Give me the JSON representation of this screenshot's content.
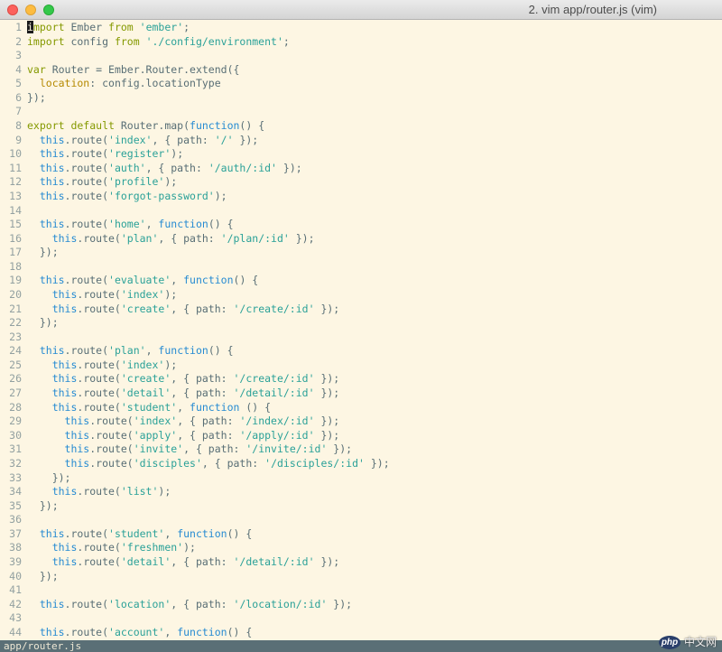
{
  "window": {
    "title": "2. vim app/router.js (vim)"
  },
  "editor": {
    "lines": [
      {
        "n": "1",
        "tokens": [
          {
            "t": "i",
            "c": "kw cursor"
          },
          {
            "t": "mport ",
            "c": "kw"
          },
          {
            "t": "Ember ",
            "c": ""
          },
          {
            "t": "from ",
            "c": "kw"
          },
          {
            "t": "'ember'",
            "c": "str"
          },
          {
            "t": ";",
            "c": ""
          }
        ]
      },
      {
        "n": "2",
        "tokens": [
          {
            "t": "import ",
            "c": "kw"
          },
          {
            "t": "config ",
            "c": ""
          },
          {
            "t": "from ",
            "c": "kw"
          },
          {
            "t": "'./config/environment'",
            "c": "str"
          },
          {
            "t": ";",
            "c": ""
          }
        ]
      },
      {
        "n": "3",
        "tokens": []
      },
      {
        "n": "4",
        "tokens": [
          {
            "t": "var ",
            "c": "kw"
          },
          {
            "t": "Router = Ember.Router.extend({",
            "c": ""
          }
        ]
      },
      {
        "n": "5",
        "tokens": [
          {
            "t": "  location",
            "c": "prop"
          },
          {
            "t": ": config.locationType",
            "c": ""
          }
        ]
      },
      {
        "n": "6",
        "tokens": [
          {
            "t": "});",
            "c": ""
          }
        ]
      },
      {
        "n": "7",
        "tokens": []
      },
      {
        "n": "8",
        "tokens": [
          {
            "t": "export default ",
            "c": "kw"
          },
          {
            "t": "Router.map(",
            "c": ""
          },
          {
            "t": "function",
            "c": "tt"
          },
          {
            "t": "() {",
            "c": ""
          }
        ]
      },
      {
        "n": "9",
        "tokens": [
          {
            "t": "  this",
            "c": "tt"
          },
          {
            "t": ".route(",
            "c": ""
          },
          {
            "t": "'index'",
            "c": "str"
          },
          {
            "t": ", { path: ",
            "c": ""
          },
          {
            "t": "'/'",
            "c": "str"
          },
          {
            "t": " });",
            "c": ""
          }
        ]
      },
      {
        "n": "10",
        "tokens": [
          {
            "t": "  this",
            "c": "tt"
          },
          {
            "t": ".route(",
            "c": ""
          },
          {
            "t": "'register'",
            "c": "str"
          },
          {
            "t": ");",
            "c": ""
          }
        ]
      },
      {
        "n": "11",
        "tokens": [
          {
            "t": "  this",
            "c": "tt"
          },
          {
            "t": ".route(",
            "c": ""
          },
          {
            "t": "'auth'",
            "c": "str"
          },
          {
            "t": ", { path: ",
            "c": ""
          },
          {
            "t": "'/auth/:id'",
            "c": "str"
          },
          {
            "t": " });",
            "c": ""
          }
        ]
      },
      {
        "n": "12",
        "tokens": [
          {
            "t": "  this",
            "c": "tt"
          },
          {
            "t": ".route(",
            "c": ""
          },
          {
            "t": "'profile'",
            "c": "str"
          },
          {
            "t": ");",
            "c": ""
          }
        ]
      },
      {
        "n": "13",
        "tokens": [
          {
            "t": "  this",
            "c": "tt"
          },
          {
            "t": ".route(",
            "c": ""
          },
          {
            "t": "'forgot-password'",
            "c": "str"
          },
          {
            "t": ");",
            "c": ""
          }
        ]
      },
      {
        "n": "14",
        "tokens": []
      },
      {
        "n": "15",
        "tokens": [
          {
            "t": "  this",
            "c": "tt"
          },
          {
            "t": ".route(",
            "c": ""
          },
          {
            "t": "'home'",
            "c": "str"
          },
          {
            "t": ", ",
            "c": ""
          },
          {
            "t": "function",
            "c": "tt"
          },
          {
            "t": "() {",
            "c": ""
          }
        ]
      },
      {
        "n": "16",
        "tokens": [
          {
            "t": "    this",
            "c": "tt"
          },
          {
            "t": ".route(",
            "c": ""
          },
          {
            "t": "'plan'",
            "c": "str"
          },
          {
            "t": ", { path: ",
            "c": ""
          },
          {
            "t": "'/plan/:id'",
            "c": "str"
          },
          {
            "t": " });",
            "c": ""
          }
        ]
      },
      {
        "n": "17",
        "tokens": [
          {
            "t": "  });",
            "c": ""
          }
        ]
      },
      {
        "n": "18",
        "tokens": []
      },
      {
        "n": "19",
        "tokens": [
          {
            "t": "  this",
            "c": "tt"
          },
          {
            "t": ".route(",
            "c": ""
          },
          {
            "t": "'evaluate'",
            "c": "str"
          },
          {
            "t": ", ",
            "c": ""
          },
          {
            "t": "function",
            "c": "tt"
          },
          {
            "t": "() {",
            "c": ""
          }
        ]
      },
      {
        "n": "20",
        "tokens": [
          {
            "t": "    this",
            "c": "tt"
          },
          {
            "t": ".route(",
            "c": ""
          },
          {
            "t": "'index'",
            "c": "str"
          },
          {
            "t": ");",
            "c": ""
          }
        ]
      },
      {
        "n": "21",
        "tokens": [
          {
            "t": "    this",
            "c": "tt"
          },
          {
            "t": ".route(",
            "c": ""
          },
          {
            "t": "'create'",
            "c": "str"
          },
          {
            "t": ", { path: ",
            "c": ""
          },
          {
            "t": "'/create/:id'",
            "c": "str"
          },
          {
            "t": " });",
            "c": ""
          }
        ]
      },
      {
        "n": "22",
        "tokens": [
          {
            "t": "  });",
            "c": ""
          }
        ]
      },
      {
        "n": "23",
        "tokens": []
      },
      {
        "n": "24",
        "tokens": [
          {
            "t": "  this",
            "c": "tt"
          },
          {
            "t": ".route(",
            "c": ""
          },
          {
            "t": "'plan'",
            "c": "str"
          },
          {
            "t": ", ",
            "c": ""
          },
          {
            "t": "function",
            "c": "tt"
          },
          {
            "t": "() {",
            "c": ""
          }
        ]
      },
      {
        "n": "25",
        "tokens": [
          {
            "t": "    this",
            "c": "tt"
          },
          {
            "t": ".route(",
            "c": ""
          },
          {
            "t": "'index'",
            "c": "str"
          },
          {
            "t": ");",
            "c": ""
          }
        ]
      },
      {
        "n": "26",
        "tokens": [
          {
            "t": "    this",
            "c": "tt"
          },
          {
            "t": ".route(",
            "c": ""
          },
          {
            "t": "'create'",
            "c": "str"
          },
          {
            "t": ", { path: ",
            "c": ""
          },
          {
            "t": "'/create/:id'",
            "c": "str"
          },
          {
            "t": " });",
            "c": ""
          }
        ]
      },
      {
        "n": "27",
        "tokens": [
          {
            "t": "    this",
            "c": "tt"
          },
          {
            "t": ".route(",
            "c": ""
          },
          {
            "t": "'detail'",
            "c": "str"
          },
          {
            "t": ", { path: ",
            "c": ""
          },
          {
            "t": "'/detail/:id'",
            "c": "str"
          },
          {
            "t": " });",
            "c": ""
          }
        ]
      },
      {
        "n": "28",
        "tokens": [
          {
            "t": "    this",
            "c": "tt"
          },
          {
            "t": ".route(",
            "c": ""
          },
          {
            "t": "'student'",
            "c": "str"
          },
          {
            "t": ", ",
            "c": ""
          },
          {
            "t": "function",
            "c": "tt"
          },
          {
            "t": " () {",
            "c": ""
          }
        ]
      },
      {
        "n": "29",
        "tokens": [
          {
            "t": "      this",
            "c": "tt"
          },
          {
            "t": ".route(",
            "c": ""
          },
          {
            "t": "'index'",
            "c": "str"
          },
          {
            "t": ", { path: ",
            "c": ""
          },
          {
            "t": "'/index/:id'",
            "c": "str"
          },
          {
            "t": " });",
            "c": ""
          }
        ]
      },
      {
        "n": "30",
        "tokens": [
          {
            "t": "      this",
            "c": "tt"
          },
          {
            "t": ".route(",
            "c": ""
          },
          {
            "t": "'apply'",
            "c": "str"
          },
          {
            "t": ", { path: ",
            "c": ""
          },
          {
            "t": "'/apply/:id'",
            "c": "str"
          },
          {
            "t": " });",
            "c": ""
          }
        ]
      },
      {
        "n": "31",
        "tokens": [
          {
            "t": "      this",
            "c": "tt"
          },
          {
            "t": ".route(",
            "c": ""
          },
          {
            "t": "'invite'",
            "c": "str"
          },
          {
            "t": ", { path: ",
            "c": ""
          },
          {
            "t": "'/invite/:id'",
            "c": "str"
          },
          {
            "t": " });",
            "c": ""
          }
        ]
      },
      {
        "n": "32",
        "tokens": [
          {
            "t": "      this",
            "c": "tt"
          },
          {
            "t": ".route(",
            "c": ""
          },
          {
            "t": "'disciples'",
            "c": "str"
          },
          {
            "t": ", { path: ",
            "c": ""
          },
          {
            "t": "'/disciples/:id'",
            "c": "str"
          },
          {
            "t": " });",
            "c": ""
          }
        ]
      },
      {
        "n": "33",
        "tokens": [
          {
            "t": "    });",
            "c": ""
          }
        ]
      },
      {
        "n": "34",
        "tokens": [
          {
            "t": "    this",
            "c": "tt"
          },
          {
            "t": ".route(",
            "c": ""
          },
          {
            "t": "'list'",
            "c": "str"
          },
          {
            "t": ");",
            "c": ""
          }
        ]
      },
      {
        "n": "35",
        "tokens": [
          {
            "t": "  });",
            "c": ""
          }
        ]
      },
      {
        "n": "36",
        "tokens": []
      },
      {
        "n": "37",
        "tokens": [
          {
            "t": "  this",
            "c": "tt"
          },
          {
            "t": ".route(",
            "c": ""
          },
          {
            "t": "'student'",
            "c": "str"
          },
          {
            "t": ", ",
            "c": ""
          },
          {
            "t": "function",
            "c": "tt"
          },
          {
            "t": "() {",
            "c": ""
          }
        ]
      },
      {
        "n": "38",
        "tokens": [
          {
            "t": "    this",
            "c": "tt"
          },
          {
            "t": ".route(",
            "c": ""
          },
          {
            "t": "'freshmen'",
            "c": "str"
          },
          {
            "t": ");",
            "c": ""
          }
        ]
      },
      {
        "n": "39",
        "tokens": [
          {
            "t": "    this",
            "c": "tt"
          },
          {
            "t": ".route(",
            "c": ""
          },
          {
            "t": "'detail'",
            "c": "str"
          },
          {
            "t": ", { path: ",
            "c": ""
          },
          {
            "t": "'/detail/:id'",
            "c": "str"
          },
          {
            "t": " });",
            "c": ""
          }
        ]
      },
      {
        "n": "40",
        "tokens": [
          {
            "t": "  });",
            "c": ""
          }
        ]
      },
      {
        "n": "41",
        "tokens": []
      },
      {
        "n": "42",
        "tokens": [
          {
            "t": "  this",
            "c": "tt"
          },
          {
            "t": ".route(",
            "c": ""
          },
          {
            "t": "'location'",
            "c": "str"
          },
          {
            "t": ", { path: ",
            "c": ""
          },
          {
            "t": "'/location/:id'",
            "c": "str"
          },
          {
            "t": " });",
            "c": ""
          }
        ]
      },
      {
        "n": "43",
        "tokens": []
      },
      {
        "n": "44",
        "tokens": [
          {
            "t": "  this",
            "c": "tt"
          },
          {
            "t": ".route(",
            "c": ""
          },
          {
            "t": "'account'",
            "c": "str"
          },
          {
            "t": ", ",
            "c": ""
          },
          {
            "t": "function",
            "c": "tt"
          },
          {
            "t": "() {",
            "c": ""
          }
        ]
      }
    ]
  },
  "statusbar": {
    "filename": "app/router.js"
  },
  "watermark": {
    "badge": "php",
    "text": "中文网"
  },
  "colors": {
    "background": "#fdf6e3",
    "keyword": "#859900",
    "string": "#2aa198",
    "this_function": "#268bd2",
    "property": "#b58900",
    "line_number": "#93a1a1",
    "statusbar": "#5a6f76"
  }
}
